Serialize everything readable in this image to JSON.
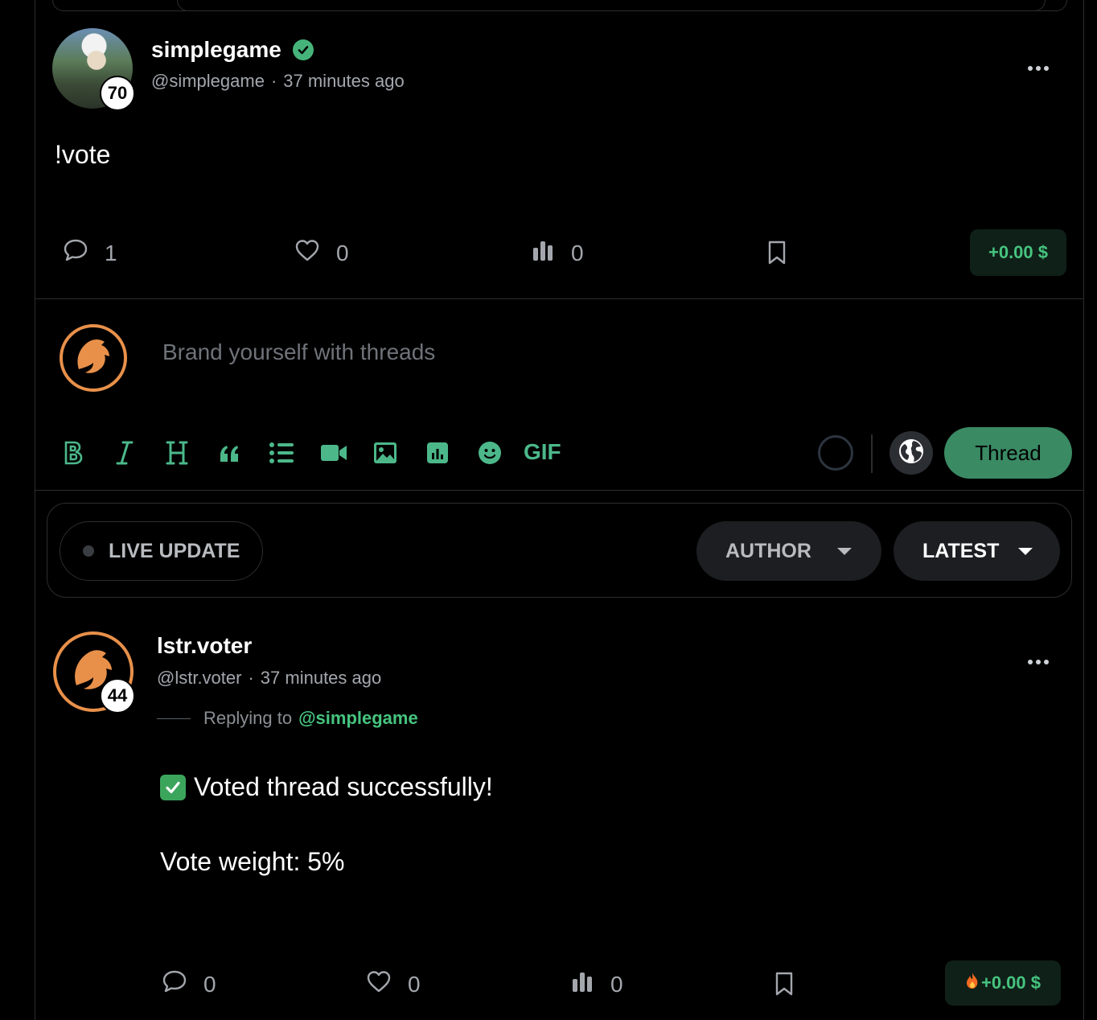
{
  "post": {
    "author_name": "simplegame",
    "author_handle": "@simplegame",
    "separator": "·",
    "time": "37 minutes ago",
    "reputation": "70",
    "body": "!vote",
    "stats": {
      "comments": "1",
      "likes": "0",
      "votes": "0"
    },
    "payout": "+0.00 $"
  },
  "composer": {
    "placeholder": "Brand yourself with threads",
    "toolbar": [
      "bold-icon",
      "italic-icon",
      "heading-icon",
      "quote-icon",
      "list-icon",
      "video-icon",
      "image-icon",
      "poll-icon",
      "emoji-icon",
      "gif"
    ],
    "gif_label": "GIF",
    "submit_label": "Thread"
  },
  "filters": {
    "live_label": "LIVE UPDATE",
    "author_label": "AUTHOR",
    "sort_label": "LATEST"
  },
  "reply": {
    "author_name": "lstr.voter",
    "author_handle": "@lstr.voter",
    "separator": "·",
    "time": "37 minutes ago",
    "reputation": "44",
    "replying_prefix": "Replying to",
    "replying_to": "@simplegame",
    "line1": "Voted thread successfully!",
    "line2": "Vote weight: 5%",
    "stats": {
      "comments": "0",
      "likes": "0",
      "votes": "0"
    },
    "payout": "+0.00 $"
  },
  "colors": {
    "accent_green": "#46c47f",
    "thread_button": "#3a8a64",
    "brand_orange": "#e8904a"
  }
}
